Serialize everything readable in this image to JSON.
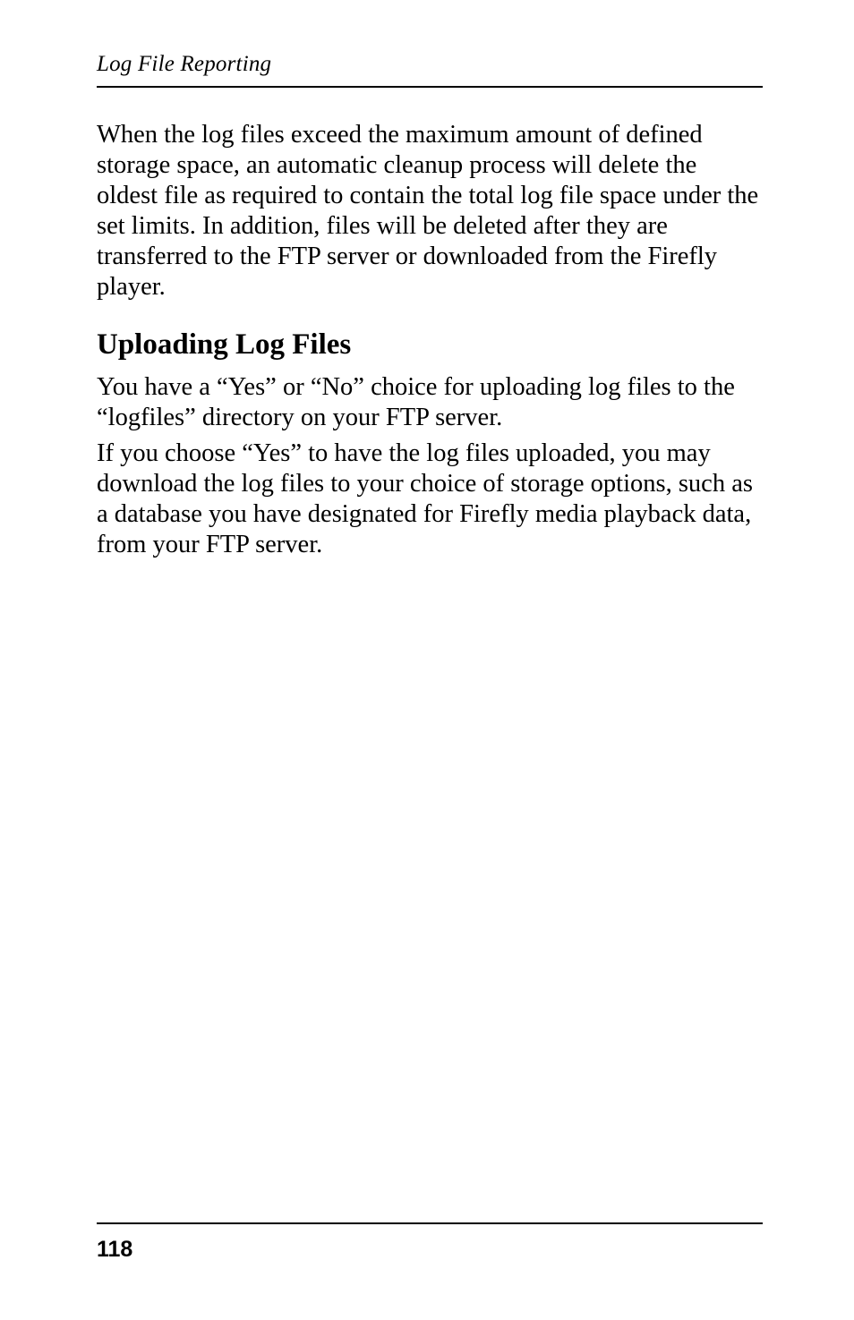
{
  "header": {
    "running_title": "Log File Reporting"
  },
  "content": {
    "para1": "When the log files exceed the maximum amount of defined storage space, an automatic cleanup process will delete the oldest file as required to contain the total log file space under the set limits. In addition, files will be deleted after they are transferred to the FTP server or downloaded from the Firefly player.",
    "section_heading": "Uploading Log Files",
    "para2": "You have a “Yes” or “No” choice for uploading log files to the “logfiles” directory on your FTP server.",
    "para3": "If you choose “Yes” to have the log files uploaded, you may download the log files to your choice of storage options, such as a database you have designated for Firefly media playback data, from your FTP server."
  },
  "footer": {
    "page_number": "118"
  }
}
